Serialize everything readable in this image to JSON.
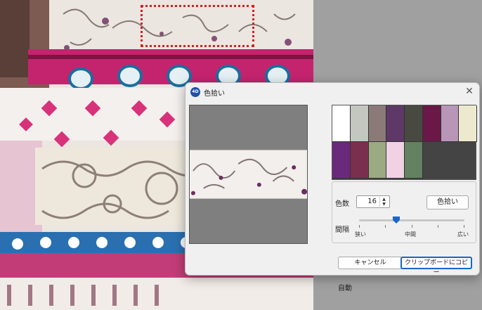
{
  "dialog": {
    "title": "色拾い",
    "close_icon": "close-icon",
    "app_icon": "4d-app-icon",
    "auto_label": "自動",
    "colors_label": "色数",
    "colors_value": "16",
    "pick_button": "色拾い",
    "interval_label": "間隔",
    "interval_level": 0.35,
    "interval_marks": [
      "狭い",
      "中間",
      "広い"
    ],
    "cancel_button": "キャンセル",
    "copy_button": "クリップボードにコピー"
  },
  "palette": {
    "colors": [
      "#ffffff",
      "#c4c6c0",
      "#8b7a78",
      "#5e3866",
      "#484a42",
      "#6a1848",
      "#b896b8",
      "#ece9cf",
      "#692a7b",
      "#7a2f4e",
      "#9baa83",
      "#f0d2e4",
      "#648162"
    ]
  },
  "colors": {
    "accent": "#1a66c8",
    "selection_border": "#d42020",
    "preview_bg": "#7f7f7f"
  }
}
